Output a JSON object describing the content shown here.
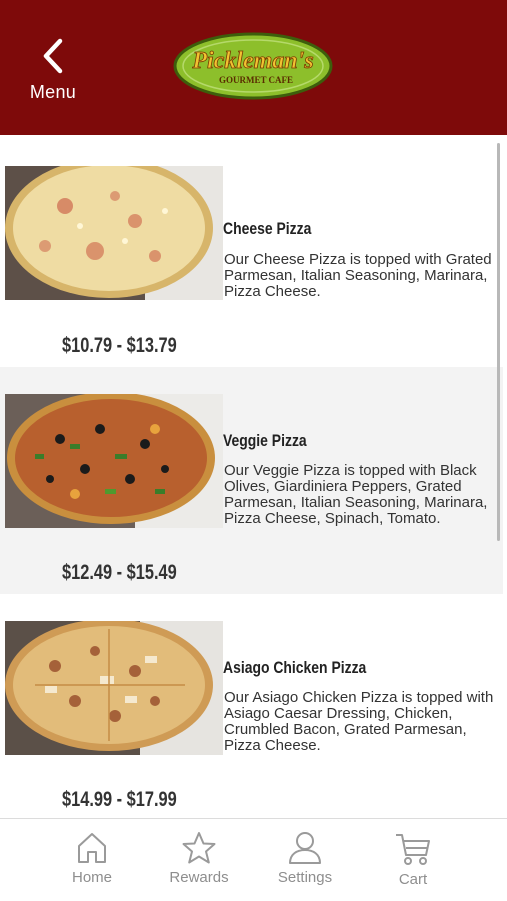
{
  "header": {
    "back_label": "Menu",
    "brand_name": "Pickleman's",
    "brand_sub": "GOURMET CAFE",
    "bg_color": "#7e0a0a"
  },
  "items": [
    {
      "name": "Cheese Pizza",
      "description": "Our Cheese Pizza is topped with Grated Parmesan, Italian Seasoning, Marinara, Pizza Cheese.",
      "price": "$10.79 - $13.79"
    },
    {
      "name": "Veggie Pizza",
      "description": "Our Veggie Pizza is topped with Black Olives, Giardiniera Peppers, Grated Parmesan, Italian Seasoning, Marinara, Pizza Cheese, Spinach, Tomato.",
      "price": "$12.49 - $15.49"
    },
    {
      "name": "Asiago Chicken Pizza",
      "description": "Our Asiago Chicken Pizza is topped with Asiago Caesar Dressing, Chicken, Crumbled Bacon, Grated Parmesan, Pizza Cheese.",
      "price": "$14.99 - $17.99"
    }
  ],
  "tabs": [
    {
      "label": "Home",
      "icon": "home-icon"
    },
    {
      "label": "Rewards",
      "icon": "star-icon"
    },
    {
      "label": "Settings",
      "icon": "user-icon"
    },
    {
      "label": "Cart",
      "icon": "cart-icon"
    }
  ]
}
